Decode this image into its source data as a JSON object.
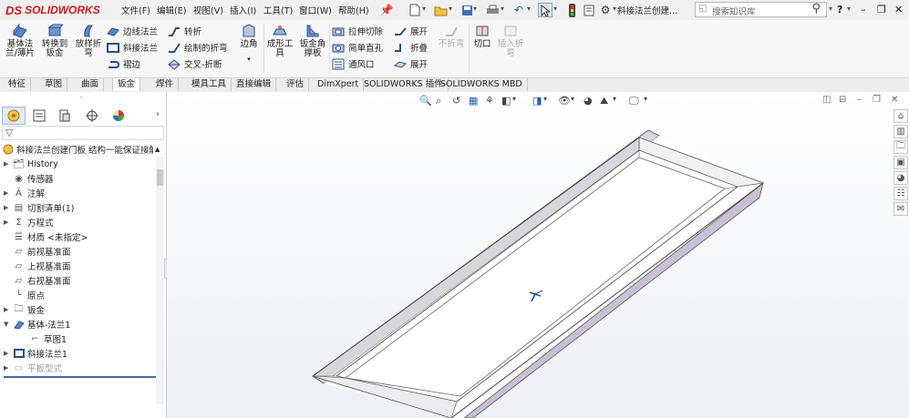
{
  "app": {
    "brand": "SOLIDWORKS",
    "brand_mark": "DS",
    "document_title": "斜接法兰创建..."
  },
  "menu": [
    "文件(F)",
    "编辑(E)",
    "视图(V)",
    "插入(I)",
    "工具(T)",
    "窗口(W)",
    "帮助(H)"
  ],
  "search": {
    "placeholder": "搜索知识库"
  },
  "window_controls": {
    "help": "?",
    "minimize": "–",
    "restore": "❐",
    "close": "✕"
  },
  "ribbon": {
    "big_buttons": [
      {
        "label": "基体法\n兰/薄片",
        "icon": "base-flange-icon"
      },
      {
        "label": "转换到\n钣金",
        "icon": "convert-sheetmetal-icon"
      },
      {
        "label": "放样折\n弯",
        "icon": "lofted-bend-icon"
      }
    ],
    "col1": [
      "边线法兰",
      "斜接法兰",
      "褶边"
    ],
    "col2": [
      "转折",
      "绘制的折弯",
      "交叉-折断"
    ],
    "corner_label": "边角",
    "forming_tool": "成形工\n具",
    "gusset": "钣金角\n撑板",
    "col3": [
      "拉伸切除",
      "简单直孔",
      "通风口"
    ],
    "col4": [
      "展开",
      "折叠",
      "展开"
    ],
    "unfold_disabled": "不折弯",
    "cut": "切口",
    "insert_bends": "插入折\n弯"
  },
  "tabs": [
    "特征",
    "草图",
    "曲面",
    "钣金",
    "焊件",
    "模具工具",
    "直接编辑",
    "评估",
    "DimXpert",
    "SOLIDWORKS 插件",
    "SOLIDWORKS MBD"
  ],
  "active_tab": "钣金",
  "tree": {
    "root": "斜接法兰创建门板 结构一能保证接触面",
    "items": [
      {
        "label": "History",
        "expandable": true
      },
      {
        "label": "传感器",
        "expandable": false
      },
      {
        "label": "注解",
        "expandable": true
      },
      {
        "label": "切割清单(1)",
        "expandable": true
      },
      {
        "label": "方程式",
        "expandable": true
      },
      {
        "label": "材质 <未指定>",
        "expandable": false
      },
      {
        "label": "前视基准面",
        "expandable": false
      },
      {
        "label": "上视基准面",
        "expandable": false
      },
      {
        "label": "右视基准面",
        "expandable": false
      },
      {
        "label": "原点",
        "expandable": false
      },
      {
        "label": "钣金",
        "expandable": true
      },
      {
        "label": "基体-法兰1",
        "expandable": true
      },
      {
        "label": "草图1",
        "expandable": false
      },
      {
        "label": "斜接法兰1",
        "expandable": true
      },
      {
        "label": "平板型式",
        "expandable": true
      }
    ]
  },
  "colors": {
    "brand": "#d1181b",
    "tab_active": "#ffffff",
    "viewport_bg": "#f4f6f9",
    "model_side": "#c9c0d4"
  }
}
